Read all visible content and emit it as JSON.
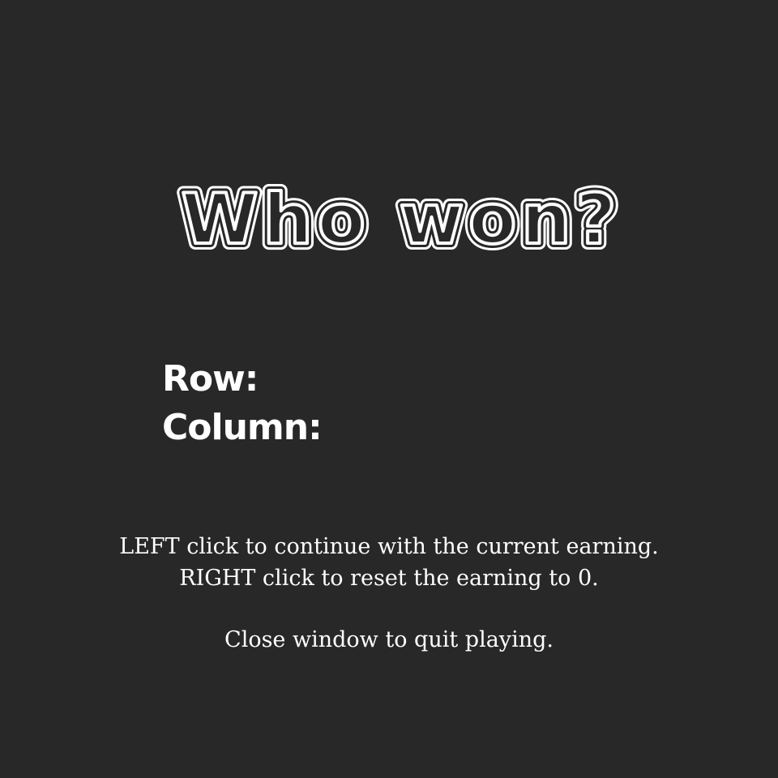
{
  "title": "Who won?",
  "result": {
    "row_label": "Row:",
    "column_label": "Column:"
  },
  "instructions": {
    "line1": "LEFT click to continue with the current earning.",
    "line2": "RIGHT click to reset the earning to 0.",
    "line3": "Close window to quit playing."
  }
}
